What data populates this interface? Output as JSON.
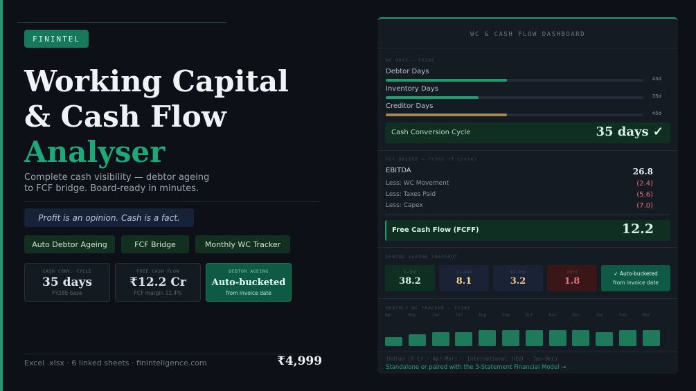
{
  "brand": "FININTEL",
  "title": {
    "line1": "Working Capital",
    "line2": "& Cash Flow",
    "line3": "Analyser"
  },
  "subtitle": {
    "line1": "Complete cash visibility — debtor ageing",
    "line2": "to FCF bridge. Board-ready in minutes."
  },
  "quote": "Profit is an opinion. Cash is a fact.",
  "features": [
    "Auto Debtor Ageing",
    "FCF Bridge",
    "Monthly WC Tracker"
  ],
  "stats": [
    {
      "label": "CASH CONV. CYCLE",
      "value": "35 days",
      "sub": "FY28E base"
    },
    {
      "label": "FREE CASH FLOW",
      "value": "₹12.2 Cr",
      "sub": "FCF margin 11.4%"
    },
    {
      "label": "DEBTOR AGEING",
      "value": "Auto-bucketed",
      "sub": "from invoice date"
    }
  ],
  "footer": "Excel .xlsx · 6 linked sheets · fininteligence.com",
  "price": "₹4,999",
  "colors": {
    "accent": "#1f9d6e",
    "negative": "#e5727a",
    "creditor_bar": "#a38a53"
  },
  "dashboard": {
    "title": "WC & CASH FLOW DASHBOARD",
    "wc_section": "WC DAYS — FY28E",
    "wc_days": [
      {
        "name": "Debtor Days",
        "value": "45d",
        "fill": 0.47
      },
      {
        "name": "Inventory Days",
        "value": "35d",
        "fill": 0.36
      },
      {
        "name": "Creditor Days",
        "value": "45d",
        "fill": 0.47
      }
    ],
    "ccc_label": "Cash Conversion Cycle",
    "ccc_value": "35 days ✓",
    "fcf_section": "FCF BRIDGE — FY28E (₹ Crore)",
    "fcf_rows": [
      {
        "label": "EBITDA",
        "value": "26.8"
      },
      {
        "label": "Less: WC Movement",
        "value": "(2.4)"
      },
      {
        "label": "Less: Taxes Paid",
        "value": "(5.6)"
      },
      {
        "label": "Less: Capex",
        "value": "(7.0)"
      }
    ],
    "fcff_label": "Free Cash Flow (FCFF)",
    "fcff_value": "12.2",
    "ageing_section": "DEBTOR AGEING SNAPSHOT",
    "ageing": [
      {
        "label": "0–30d",
        "value": "38.2"
      },
      {
        "label": "31–60d",
        "value": "8.1"
      },
      {
        "label": "61–90d",
        "value": "3.2"
      },
      {
        "label": "90+d",
        "value": "1.8"
      }
    ],
    "ageing_note": {
      "line1": "✓ Auto-bucketed",
      "line2": "from invoice date"
    },
    "monthly_section": "MONTHLY WC TRACKER — FY28E",
    "months": [
      {
        "label": "Apr",
        "level": 0.45
      },
      {
        "label": "May",
        "level": 0.58
      },
      {
        "label": "Jun",
        "level": 0.68
      },
      {
        "label": "Jul",
        "level": 0.68
      },
      {
        "label": "Aug",
        "level": 0.78
      },
      {
        "label": "Sep",
        "level": 0.78
      },
      {
        "label": "Oct",
        "level": 0.78
      },
      {
        "label": "Nov",
        "level": 0.78
      },
      {
        "label": "Dec",
        "level": 0.78
      },
      {
        "label": "Jan",
        "level": 0.68
      },
      {
        "label": "Feb",
        "level": 0.78
      },
      {
        "label": "Mar",
        "level": 0.78
      }
    ],
    "footnote": "Indian (₹ Cr · Apr–Mar) · International (USD · Jan–Dec)",
    "link": "Standalone or paired with the 3-Statement Financial Model →"
  }
}
